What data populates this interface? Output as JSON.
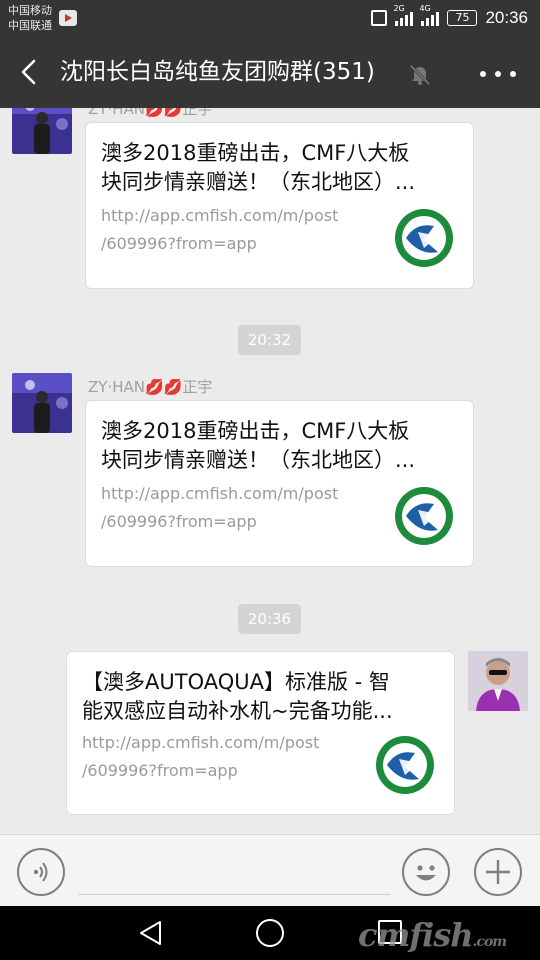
{
  "status_bar": {
    "carrier_1": "中国移动",
    "carrier_2": "中国联通",
    "network_1": "2G",
    "network_2": "4G",
    "battery": "75",
    "time": "20:36"
  },
  "header": {
    "title": "沈阳长白岛纯鱼友团购群(351)",
    "back_icon": "chevron-left-icon",
    "mute_icon": "bell-off-icon",
    "more_icon": "more-dots-icon"
  },
  "messages": [
    {
      "sender": "ZY·HAN💋💋正宇",
      "title_line1": "澳多2018重磅出击，CMF八大板",
      "title_line2": "块同步情亲赠送！（东北地区）...",
      "url_line1": "http://app.cmfish.com/m/post",
      "url_line2": "/609996?from=app"
    },
    {
      "timestamp": "20:32",
      "sender": "ZY·HAN💋💋正宇",
      "title_line1": "澳多2018重磅出击，CMF八大板",
      "title_line2": "块同步情亲赠送！（东北地区）...",
      "url_line1": "http://app.cmfish.com/m/post",
      "url_line2": "/609996?from=app"
    },
    {
      "timestamp": "20:36",
      "title_line1": "【澳多AUTOAQUA】标准版 - 智",
      "title_line2": "能双感应自动补水机~完备功能...",
      "url_line1": "http://app.cmfish.com/m/post",
      "url_line2": "/609996?from=app"
    }
  ],
  "input_bar": {
    "voice_icon": "voice-icon",
    "emoji_icon": "emoji-icon",
    "plus_icon": "plus-icon",
    "placeholder": ""
  },
  "nav_bar": {
    "back_icon": "nav-back-icon",
    "home_icon": "nav-home-icon",
    "recent_icon": "nav-recent-icon",
    "watermark_main": "cmfish",
    "watermark_suffix": ".com"
  },
  "colors": {
    "bar": "#353535",
    "chat_bg": "#ebebeb",
    "thumb_green": "#1e8a3c",
    "thumb_blue": "#1f5fa8"
  }
}
